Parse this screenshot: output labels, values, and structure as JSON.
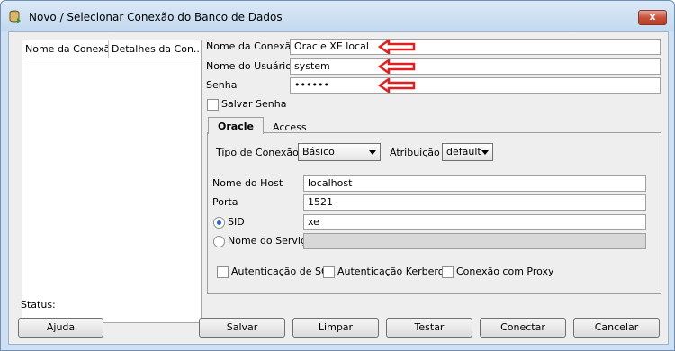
{
  "window": {
    "title": "Novo / Selecionar Conexão do Banco de Dados",
    "close_label": "x"
  },
  "connections_table": {
    "columns": [
      "Nome da Conexão",
      "Detalhes da Con..."
    ]
  },
  "form": {
    "conn_name_label": "Nome da Conexão",
    "conn_name_value": "Oracle XE local",
    "user_label": "Nome do Usuário",
    "user_value": "system",
    "password_label": "Senha",
    "password_value": "••••••",
    "save_password_label": "Salvar Senha",
    "save_password_checked": false
  },
  "tabs": {
    "active": "Oracle",
    "inactive": "Access"
  },
  "oracle": {
    "conn_type_label": "Tipo de Conexão",
    "conn_type_value": "Básico",
    "role_label": "Atribuição",
    "role_value": "default",
    "host_label": "Nome do Host",
    "host_value": "localhost",
    "port_label": "Porta",
    "port_value": "1521",
    "sid_label": "SID",
    "sid_value": "xe",
    "sid_selected": true,
    "service_label": "Nome do Serviço",
    "service_value": "",
    "os_auth_label": "Autenticação de SO",
    "kerberos_label": "Autenticação Kerberos",
    "proxy_label": "Conexão com Proxy"
  },
  "status_label": "Status:",
  "buttons": {
    "help": "Ajuda",
    "save": "Salvar",
    "clear": "Limpar",
    "test": "Testar",
    "connect": "Conectar",
    "cancel": "Cancelar"
  },
  "colors": {
    "annotation_arrow": "#e02020",
    "radio_selected": "#2f67c8"
  }
}
